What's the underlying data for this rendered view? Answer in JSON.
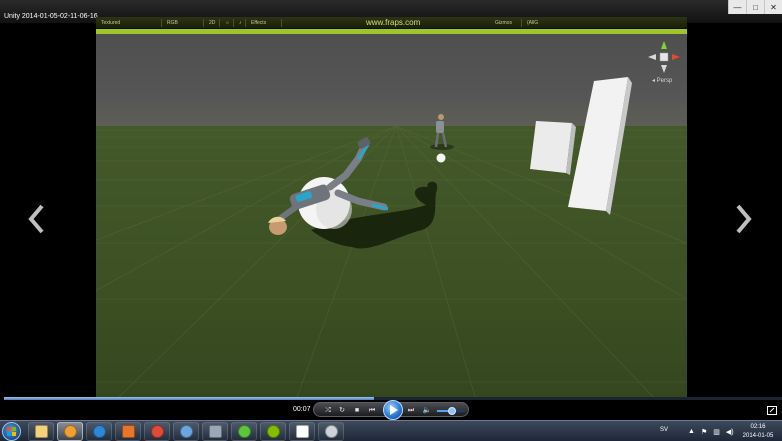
{
  "window": {
    "title": "Unity 2014-01-05-02-11-06-16",
    "controls": [
      "—",
      "□",
      "✕"
    ]
  },
  "unity_toolbar": {
    "render_mode": "Textured",
    "color_mode": "RGB",
    "mode_2d": "2D",
    "effects": "Effects",
    "gizmos": "Gizmos",
    "search": "(AllG",
    "watermark": "www.fraps.com",
    "persp_label": "◂ Persp"
  },
  "player": {
    "time": "00:07",
    "progress": 0.475,
    "volume": 0.55
  },
  "taskbar": {
    "items": [
      {
        "name": "explorer",
        "color": "#f3d37a"
      },
      {
        "name": "media-player",
        "color": "#f0a030",
        "active": true
      },
      {
        "name": "internet-explorer",
        "color": "#2f86d6"
      },
      {
        "name": "firefox",
        "color": "#e8762a"
      },
      {
        "name": "chrome",
        "color": "#e04a3a"
      },
      {
        "name": "photo-viewer",
        "color": "#6aa6e0"
      },
      {
        "name": "steam",
        "color": "#9aa7b8"
      },
      {
        "name": "utorrent",
        "color": "#5cc73a"
      },
      {
        "name": "spotify",
        "color": "#84bd00"
      },
      {
        "name": "unity",
        "color": "#ffffff"
      },
      {
        "name": "unity-web",
        "color": "#cfd4da"
      }
    ],
    "language": "SV",
    "clock_time": "02:16",
    "clock_date": "2014-01-05"
  },
  "colors": {
    "ground": "#3c5023",
    "sky": "#555555",
    "accent_lime": "#9ec52a",
    "player_blue": "#2b7ad6"
  }
}
